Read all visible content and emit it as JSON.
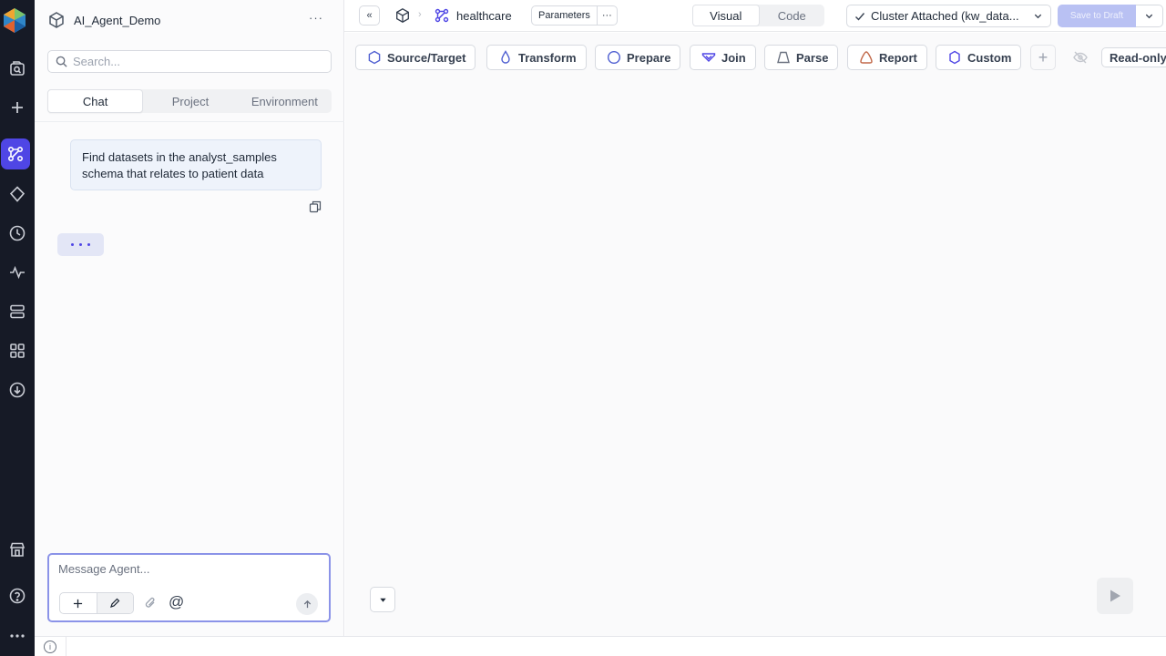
{
  "sidebar": {
    "project_name": "AI_Agent_Demo",
    "more_label": "···",
    "search_placeholder": "Search...",
    "tabs": [
      {
        "label": "Chat",
        "active": true
      },
      {
        "label": "Project",
        "active": false
      },
      {
        "label": "Environment",
        "active": false
      }
    ]
  },
  "chat": {
    "messages": [
      {
        "role": "user",
        "text": "Find datasets in the analyst_samples schema that relates to patient data"
      }
    ],
    "agent_typing": true,
    "composer_placeholder": "Message Agent...",
    "at_label": "@"
  },
  "topbar": {
    "collapse_label": "«",
    "pipeline_name": "healthcare",
    "parameters_label": "Parameters",
    "parameters_more": "···",
    "view_tabs": [
      {
        "label": "Visual",
        "active": true
      },
      {
        "label": "Code",
        "active": false
      }
    ],
    "cluster_label": "Cluster Attached (kw_data...",
    "save_label": "Save to Draft"
  },
  "canvas": {
    "gems": [
      {
        "label": "Source/Target",
        "icon": "hexagon-icon",
        "color": "#4f5fd1"
      },
      {
        "label": "Transform",
        "icon": "droplet-icon",
        "color": "#4f5fd1"
      },
      {
        "label": "Prepare",
        "icon": "octagon-icon",
        "color": "#4f5fd1"
      },
      {
        "label": "Join",
        "icon": "join-icon",
        "color": "#4f46e5"
      },
      {
        "label": "Parse",
        "icon": "trapezoid-icon",
        "color": "#6b7280"
      },
      {
        "label": "Report",
        "icon": "report-icon",
        "color": "#c2694a"
      },
      {
        "label": "Custom",
        "icon": "hexagon-icon",
        "color": "#4f46e5"
      }
    ],
    "add_label": "+",
    "readonly_label": "Read-only"
  },
  "colors": {
    "accent": "#4f46e5",
    "rail_bg": "#161a26",
    "sidebar_bg": "#fbfbfc",
    "canvas_bg": "#fafafb"
  }
}
